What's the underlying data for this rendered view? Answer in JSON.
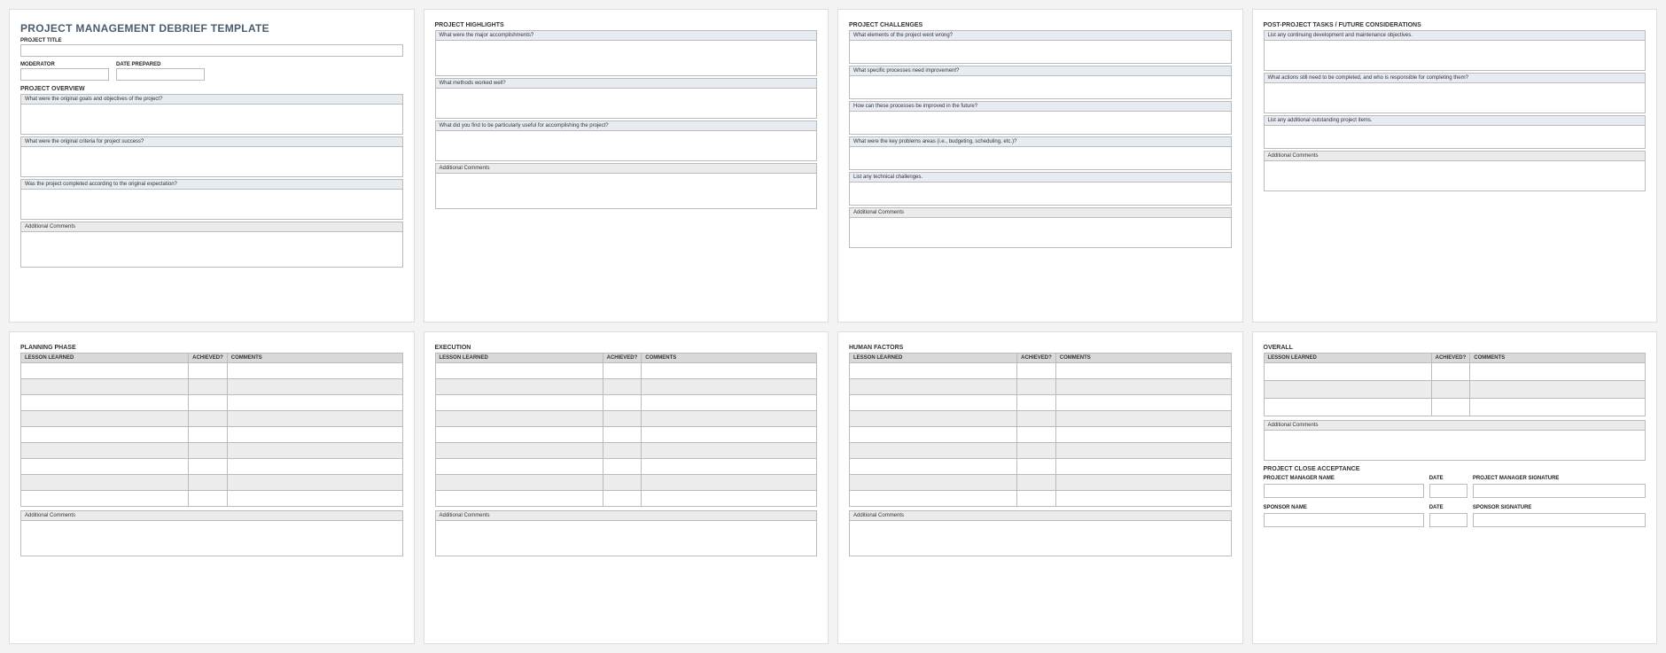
{
  "titles": {
    "main": "PROJECT MANAGEMENT DEBRIEF TEMPLATE",
    "project_title_label": "PROJECT TITLE",
    "moderator_label": "MODERATOR",
    "date_prepared_label": "DATE PREPARED",
    "overview": "PROJECT OVERVIEW",
    "highlights": "PROJECT HIGHLIGHTS",
    "challenges": "PROJECT CHALLENGES",
    "post_project": "POST-PROJECT TASKS / FUTURE CONSIDERATIONS",
    "planning": "PLANNING PHASE",
    "execution": "EXECUTION",
    "human": "HUMAN FACTORS",
    "overall": "OVERALL",
    "close_acceptance": "PROJECT CLOSE ACCEPTANCE",
    "additional_comments": "Additional Comments"
  },
  "overview_q": {
    "q1": "What were the original goals and objectives of the project?",
    "q2": "What were the original criteria for project success?",
    "q3": "Was the project completed according to the original expectation?"
  },
  "highlights_q": {
    "q1": "What were the major accomplishments?",
    "q2": "What methods worked well?",
    "q3": "What did you find to be particularly useful for accomplishing the project?"
  },
  "challenges_q": {
    "q1": "What elements of the project went wrong?",
    "q2": "What specific processes need improvement?",
    "q3": "How can these processes be improved in the future?",
    "q4": "What were the key problems areas (i.e., budgeting, scheduling, etc.)?",
    "q5": "List any technical challenges."
  },
  "post_q": {
    "q1": "List any continuing development and maintenance objectives.",
    "q2": "What actions still need to be completed, and who is responsible for completing them?",
    "q3": "List any additional outstanding project items."
  },
  "lessons_header": {
    "lesson": "LESSON LEARNED",
    "achieved": "ACHIEVED?",
    "comments": "COMMENTS"
  },
  "signatures": {
    "pm_name": "PROJECT MANAGER NAME",
    "date": "DATE",
    "pm_sig": "PROJECT MANAGER SIGNATURE",
    "sponsor_name": "SPONSOR NAME",
    "sponsor_sig": "SPONSOR SIGNATURE"
  }
}
